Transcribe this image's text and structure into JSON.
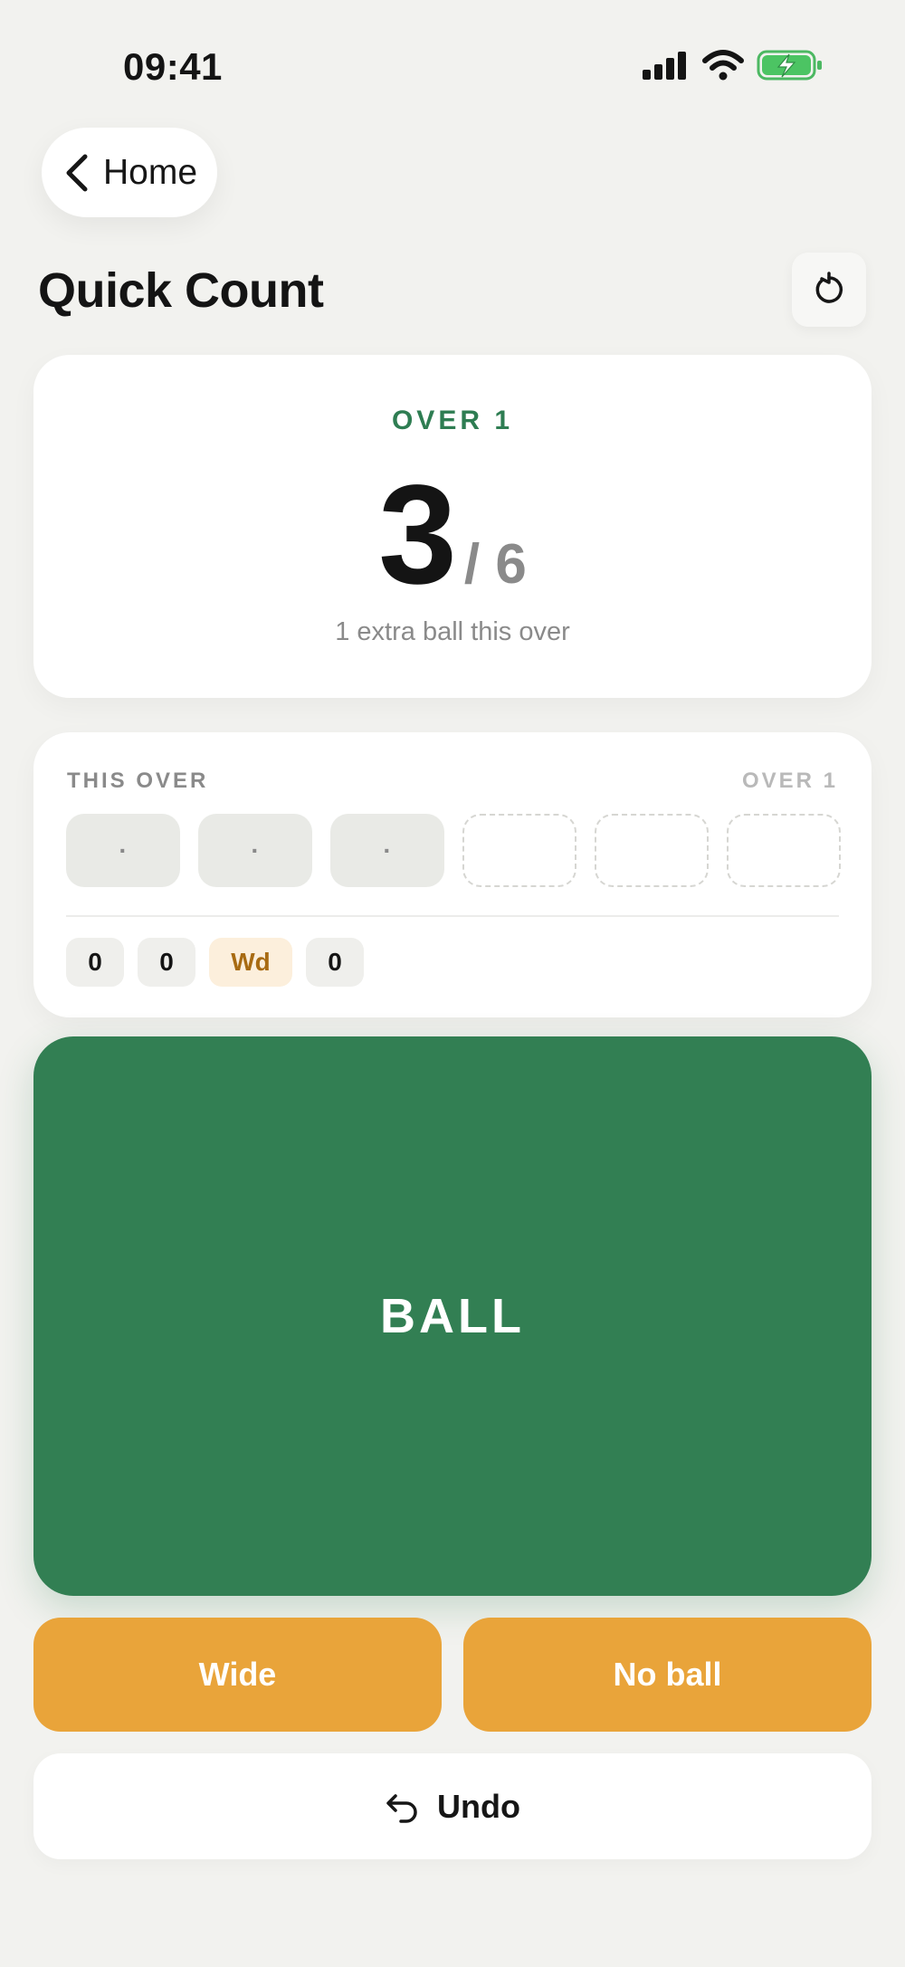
{
  "status_bar": {
    "time": "09:41"
  },
  "nav": {
    "back_label": "Home"
  },
  "header": {
    "title": "Quick Count"
  },
  "counter": {
    "over_label": "OVER 1",
    "balls_bowled": "3",
    "balls_per_over": "/ 6",
    "extra_note": "1 extra ball this over"
  },
  "this_over": {
    "title": "THIS OVER",
    "over_label": "OVER 1",
    "slots": [
      {
        "value": "·",
        "state": "filled"
      },
      {
        "value": "·",
        "state": "filled"
      },
      {
        "value": "·",
        "state": "filled"
      },
      {
        "value": "",
        "state": "empty"
      },
      {
        "value": "",
        "state": "empty"
      },
      {
        "value": "",
        "state": "empty"
      }
    ],
    "history": [
      {
        "label": "0",
        "kind": "legal"
      },
      {
        "label": "0",
        "kind": "legal"
      },
      {
        "label": "Wd",
        "kind": "extra"
      },
      {
        "label": "0",
        "kind": "legal"
      }
    ]
  },
  "actions": {
    "ball_label": "BALL",
    "wide_label": "Wide",
    "no_ball_label": "No ball",
    "undo_label": "Undo"
  },
  "colors": {
    "primary_green": "#327f53",
    "accent_orange": "#e9a43a",
    "background": "#f2f2ef"
  }
}
